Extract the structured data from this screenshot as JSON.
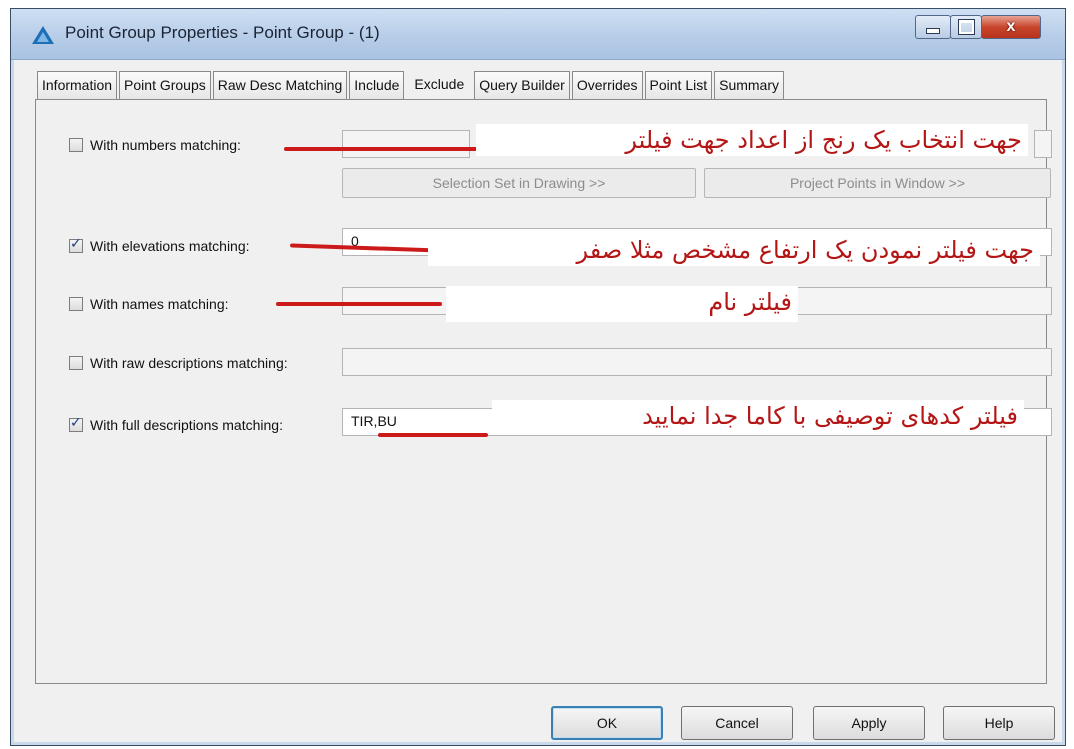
{
  "window": {
    "title": "Point Group Properties - Point Group - (1)",
    "close_glyph": "x"
  },
  "tabs": [
    {
      "label": "Information"
    },
    {
      "label": "Point Groups"
    },
    {
      "label": "Raw Desc Matching"
    },
    {
      "label": "Include"
    },
    {
      "label": "Exclude",
      "active": true
    },
    {
      "label": "Query Builder"
    },
    {
      "label": "Overrides"
    },
    {
      "label": "Point List"
    },
    {
      "label": "Summary"
    }
  ],
  "exclude": {
    "numbers": {
      "label": "With numbers matching:",
      "checked": false,
      "value": ""
    },
    "selection_set_button": "Selection Set in Drawing >>",
    "project_points_button": "Project Points in Window >>",
    "elevations": {
      "label": "With elevations matching:",
      "checked": true,
      "value": "0"
    },
    "names": {
      "label": "With names matching:",
      "checked": false,
      "value": ""
    },
    "raw_descriptions": {
      "label": "With raw descriptions matching:",
      "checked": false,
      "value": ""
    },
    "full_descriptions": {
      "label": "With full descriptions matching:",
      "checked": true,
      "value": "TIR,BU"
    }
  },
  "annotations": {
    "numbers_note": "جهت انتخاب یک رنج از اعداد جهت فیلتر",
    "elevations_note": "جهت فیلتر نمودن یک ارتفاع مشخص مثلا صفر",
    "names_note": "فیلتر نام",
    "full_desc_note": "فیلتر کدهای توصیفی با کاما جدا نمایید",
    "color": "#b41515"
  },
  "buttons": {
    "ok": "OK",
    "cancel": "Cancel",
    "apply": "Apply",
    "help": "Help"
  },
  "icons": {
    "app": "civil3d-triangle-icon",
    "minimize": "minimize-icon",
    "maximize": "maximize-icon",
    "close": "close-icon"
  }
}
